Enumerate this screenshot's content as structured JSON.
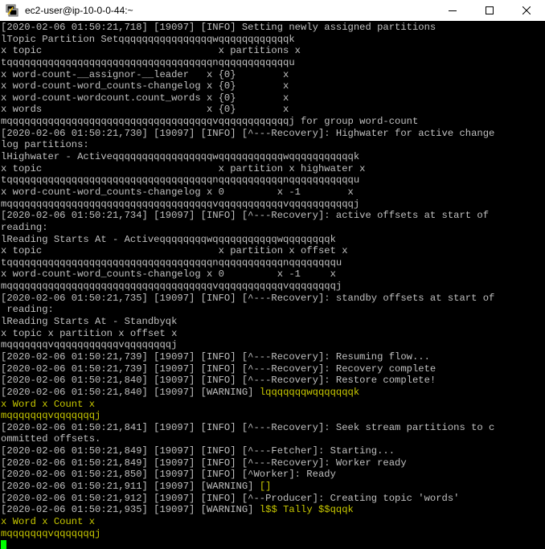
{
  "window": {
    "title": "ec2-user@ip-10-0-0-44:~",
    "icon": "putty-terminal-icon",
    "controls": [
      "minimize-icon",
      "maximize-icon",
      "close-icon"
    ]
  },
  "colors": {
    "terminal_bg": "#000000",
    "terminal_fg": "#c0c0c0",
    "highlight": "#c7c700",
    "cursor": "#00ff00"
  },
  "terminal": {
    "lines": [
      [
        {
          "t": "[2020-02-06 01:50:21,718] [19097] [INFO] Setting newly assigned partitions"
        }
      ],
      [
        {
          "t": "lTopic Partition Setqqqqqqqqqqqqqqqqwqqqqqqqqqqqqk"
        }
      ],
      [
        {
          "t": "x topic                              x partitions x"
        }
      ],
      [
        {
          "t": "tqqqqqqqqqqqqqqqqqqqqqqqqqqqqqqqqqqqnqqqqqqqqqqqqu"
        }
      ],
      [
        {
          "t": "x word-count-__assignor-__leader   x {0}        x"
        }
      ],
      [
        {
          "t": "x word-count-word_counts-changelog x {0}        x"
        }
      ],
      [
        {
          "t": "x word-count-wordcount.count_words x {0}        x"
        }
      ],
      [
        {
          "t": "x words                            x {0}        x"
        }
      ],
      [
        {
          "t": "mqqqqqqqqqqqqqqqqqqqqqqqqqqqqqqqqqqqvqqqqqqqqqqqqj for group word-count"
        }
      ],
      [
        {
          "t": "[2020-02-06 01:50:21,730] [19097] [INFO] [^---Recovery]: Highwater for active change"
        }
      ],
      [
        {
          "t": "log partitions:"
        }
      ],
      [
        {
          "t": "lHighwater - Activeqqqqqqqqqqqqqqqqqwqqqqqqqqqqqwqqqqqqqqqqqk"
        }
      ],
      [
        {
          "t": "x topic                              x partition x highwater x"
        }
      ],
      [
        {
          "t": "tqqqqqqqqqqqqqqqqqqqqqqqqqqqqqqqqqqqnqqqqqqqqqqqnqqqqqqqqqqqu"
        }
      ],
      [
        {
          "t": "x word-count-word_counts-changelog x 0         x -1        x"
        }
      ],
      [
        {
          "t": "mqqqqqqqqqqqqqqqqqqqqqqqqqqqqqqqqqqqvqqqqqqqqqqqvqqqqqqqqqqqj"
        }
      ],
      [
        {
          "t": "[2020-02-06 01:50:21,734] [19097] [INFO] [^---Recovery]: active offsets at start of"
        }
      ],
      [
        {
          "t": "reading:"
        }
      ],
      [
        {
          "t": "lReading Starts At - Activeqqqqqqqqwqqqqqqqqqqqwqqqqqqqqk"
        }
      ],
      [
        {
          "t": "x topic                              x partition x offset x"
        }
      ],
      [
        {
          "t": "tqqqqqqqqqqqqqqqqqqqqqqqqqqqqqqqqqqqnqqqqqqqqqqqnqqqqqqqqu"
        }
      ],
      [
        {
          "t": "x word-count-word_counts-changelog x 0         x -1     x"
        }
      ],
      [
        {
          "t": "mqqqqqqqqqqqqqqqqqqqqqqqqqqqqqqqqqqqvqqqqqqqqqqqvqqqqqqqqj"
        }
      ],
      [
        {
          "t": "[2020-02-06 01:50:21,735] [19097] [INFO] [^---Recovery]: standby offsets at start of"
        }
      ],
      [
        {
          "t": " reading:"
        }
      ],
      [
        {
          "t": "lReading Starts At - Standbyqk"
        }
      ],
      [
        {
          "t": "x topic x partition x offset x"
        }
      ],
      [
        {
          "t": "mqqqqqqqvqqqqqqqqqqqvqqqqqqqqj"
        }
      ],
      [
        {
          "t": "[2020-02-06 01:50:21,739] [19097] [INFO] [^---Recovery]: Resuming flow..."
        }
      ],
      [
        {
          "t": "[2020-02-06 01:50:21,739] [19097] [INFO] [^---Recovery]: Recovery complete"
        }
      ],
      [
        {
          "t": "[2020-02-06 01:50:21,840] [19097] [INFO] [^---Recovery]: Restore complete!"
        }
      ],
      [
        {
          "t": "[2020-02-06 01:50:21,840] [19097] [WARNING] "
        },
        {
          "t": "lqqqqqqqwqqqqqqqk",
          "hl": true
        }
      ],
      [
        {
          "t": "x Word x Count x",
          "hl": true
        }
      ],
      [
        {
          "t": "mqqqqqqqvqqqqqqqj",
          "hl": true
        }
      ],
      [
        {
          "t": "[2020-02-06 01:50:21,841] [19097] [INFO] [^---Recovery]: Seek stream partitions to c"
        }
      ],
      [
        {
          "t": "ommitted offsets."
        }
      ],
      [
        {
          "t": "[2020-02-06 01:50:21,849] [19097] [INFO] [^---Fetcher]: Starting..."
        }
      ],
      [
        {
          "t": "[2020-02-06 01:50:21,849] [19097] [INFO] [^---Recovery]: Worker ready"
        }
      ],
      [
        {
          "t": "[2020-02-06 01:50:21,850] [19097] [INFO] [^Worker]: Ready"
        }
      ],
      [
        {
          "t": "[2020-02-06 01:50:21,911] [19097] [WARNING] "
        },
        {
          "t": "[]",
          "hl": true
        }
      ],
      [
        {
          "t": "[2020-02-06 01:50:21,912] [19097] [INFO] [^--Producer]: Creating topic 'words'"
        }
      ],
      [
        {
          "t": "[2020-02-06 01:50:21,935] [19097] [WARNING] "
        },
        {
          "t": "l$$ Tally $$qqqk",
          "hl": true
        }
      ],
      [
        {
          "t": "x Word x Count x",
          "hl": true
        }
      ],
      [
        {
          "t": "mqqqqqqqvqqqqqqqj",
          "hl": true
        }
      ]
    ]
  }
}
